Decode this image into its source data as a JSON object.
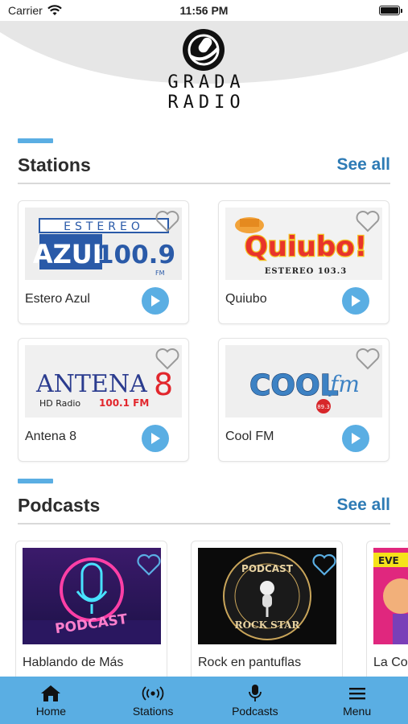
{
  "status_bar": {
    "carrier": "Carrier",
    "time": "11:56 PM"
  },
  "header": {
    "logo_line1": "GRADA",
    "logo_line2": "RADIO"
  },
  "stations": {
    "title": "Stations",
    "see_all": "See all",
    "items": [
      {
        "name": "Estero Azul",
        "logo_top": "ESTEREO",
        "logo_main": "AZUL",
        "logo_freq": "100.9",
        "logo_sub": "FM"
      },
      {
        "name": "Quiubo",
        "logo_main": "Quiubo!",
        "logo_sub": "ESTEREO 103.3"
      },
      {
        "name": "Antena 8",
        "logo_main": "ANTENA",
        "logo_num": "8",
        "logo_hd": "HD Radio",
        "logo_freq": "100.1 FM"
      },
      {
        "name": "Cool FM",
        "logo_main": "COOL",
        "logo_fm": "fm",
        "logo_freq": "89.3"
      }
    ]
  },
  "podcasts": {
    "title": "Podcasts",
    "see_all": "See all",
    "items": [
      {
        "name": "Hablando de Más",
        "art_text": "PODCAST"
      },
      {
        "name": "Rock en pantuflas",
        "art_top": "PODCAST",
        "art_bottom": "ROCK STAR"
      },
      {
        "name": "La Co",
        "art_text": "EVE"
      }
    ]
  },
  "nav": {
    "items": [
      {
        "label": "Home",
        "icon": "home-icon"
      },
      {
        "label": "Stations",
        "icon": "radio-waves-icon"
      },
      {
        "label": "Podcasts",
        "icon": "microphone-icon"
      },
      {
        "label": "Menu",
        "icon": "hamburger-icon"
      }
    ]
  },
  "colors": {
    "accent": "#5aaee3",
    "link": "#2e7bb5",
    "divider": "#d9d9d9"
  }
}
